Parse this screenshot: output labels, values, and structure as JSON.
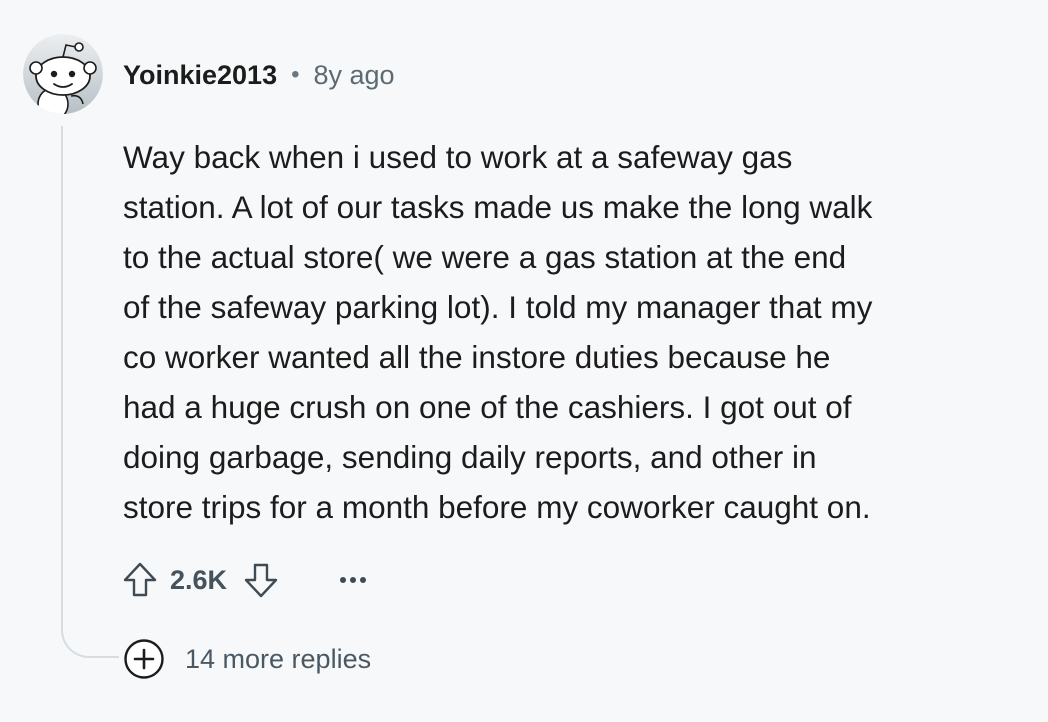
{
  "comment": {
    "username": "Yoinkie2013",
    "separator": "•",
    "timestamp": "8y ago",
    "body_lines": [
      "Way back when i used to work at a safeway gas",
      "station. A lot of our tasks made us make the long walk",
      "to the actual store( we were a gas station at the end",
      "of the safeway parking lot). I told my manager that my",
      "co worker wanted all the instore duties because he",
      "had a huge crush on one of the cashiers. I got out of",
      "doing garbage, sending daily reports, and other in",
      "store trips for a month before my coworker caught on."
    ]
  },
  "actions": {
    "score": "2.6K",
    "upvote_icon": "upvote-arrow-icon",
    "downvote_icon": "downvote-arrow-icon",
    "more_icon": "more-options-icon"
  },
  "replies": {
    "label": "14 more replies",
    "icon": "plus-circle-icon"
  },
  "colors": {
    "background": "#f7f8f9",
    "text_primary": "#1c1c1c",
    "text_secondary": "#5c6a74",
    "thread_line": "#d5dde3"
  }
}
